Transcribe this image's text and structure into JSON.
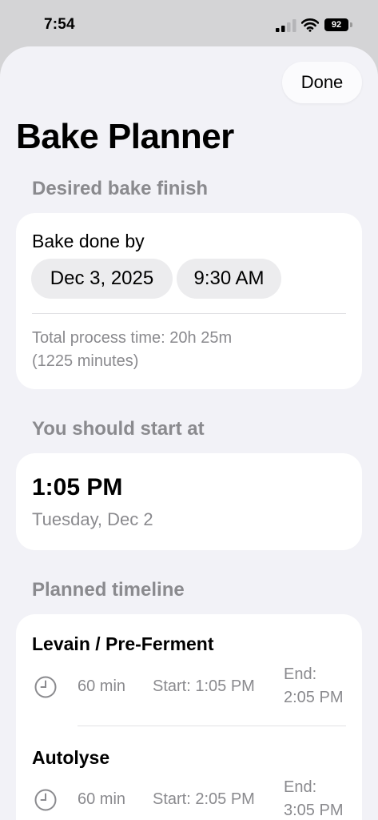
{
  "status_bar": {
    "time": "7:54",
    "battery": "92"
  },
  "header": {
    "done_label": "Done",
    "title": "Bake Planner"
  },
  "finish_section": {
    "header": "Desired bake finish",
    "label": "Bake done by",
    "date": "Dec 3, 2025",
    "time": "9:30 AM",
    "total_line1": "Total process time: 20h 25m",
    "total_line2": "(1225 minutes)"
  },
  "start_section": {
    "header": "You should start at",
    "time": "1:05 PM",
    "day": "Tuesday, Dec 2"
  },
  "timeline_section": {
    "header": "Planned timeline",
    "steps": [
      {
        "name": "Levain / Pre-Ferment",
        "duration": "60 min",
        "start": "Start: 1:05 PM",
        "end_label": "End:",
        "end_time": "2:05 PM"
      },
      {
        "name": "Autolyse",
        "duration": "60 min",
        "start": "Start: 2:05 PM",
        "end_label": "End:",
        "end_time": "3:05 PM"
      }
    ]
  },
  "icons": {
    "clock": "clock-icon",
    "signal": "cellular-signal-icon",
    "wifi": "wifi-icon",
    "battery": "battery-icon"
  }
}
